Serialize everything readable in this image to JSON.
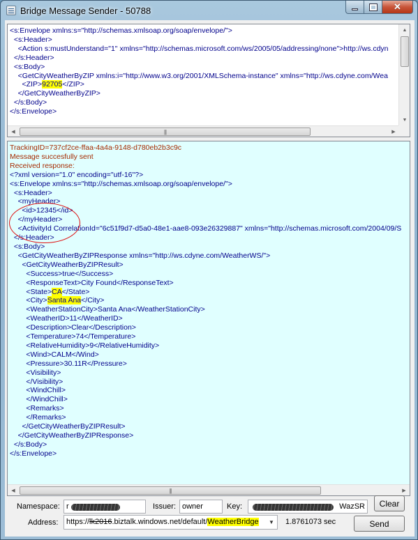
{
  "window": {
    "title": "Bridge Message Sender - 50788",
    "close_color": "#c8553a"
  },
  "request": {
    "lines": [
      {
        "indent": 0,
        "text": "<s:Envelope xmlns:s=\"http://schemas.xmlsoap.org/soap/envelope/\">"
      },
      {
        "indent": 1,
        "text": "<s:Header>"
      },
      {
        "indent": 2,
        "text": "<Action s:mustUnderstand=\"1\" xmlns=\"http://schemas.microsoft.com/ws/2005/05/addressing/none\">http://ws.cdyn"
      },
      {
        "indent": 1,
        "text": "</s:Header>"
      },
      {
        "indent": 1,
        "text": "<s:Body>"
      },
      {
        "indent": 2,
        "text": "<GetCityWeatherByZIP xmlns:i=\"http://www.w3.org/2001/XMLSchema-instance\" xmlns=\"http://ws.cdyne.com/Wea"
      },
      {
        "indent": 3,
        "pre": "<ZIP>",
        "highlight": "92705",
        "post": "</ZIP>"
      },
      {
        "indent": 2,
        "text": "</GetCityWeatherByZIP>"
      },
      {
        "indent": 1,
        "text": "</s:Body>"
      },
      {
        "indent": 0,
        "text": "</s:Envelope>"
      }
    ]
  },
  "response": {
    "status_lines": [
      "TrackingID=737cf2ce-ffaa-4a4a-9148-d780eb2b3c9c",
      "Message succesfully sent",
      "Received response:"
    ],
    "xml_lines": [
      {
        "indent": 0,
        "text": ""
      },
      {
        "indent": 0,
        "text": "<?xml version=\"1.0\" encoding=\"utf-16\"?>"
      },
      {
        "indent": 0,
        "text": "<s:Envelope xmlns:s=\"http://schemas.xmlsoap.org/soap/envelope/\">"
      },
      {
        "indent": 1,
        "text": "<s:Header>"
      },
      {
        "indent": 2,
        "text": "<myHeader>"
      },
      {
        "indent": 3,
        "text": "<id>12345</id>"
      },
      {
        "indent": 2,
        "text": "</myHeader>"
      },
      {
        "indent": 2,
        "text": "<ActivityId CorrelationId=\"6c51f9d7-d5a0-48e1-aae8-093e26329887\" xmlns=\"http://schemas.microsoft.com/2004/09/S"
      },
      {
        "indent": 1,
        "text": "</s:Header>"
      },
      {
        "indent": 1,
        "text": "<s:Body>"
      },
      {
        "indent": 2,
        "text": "<GetCityWeatherByZIPResponse xmlns=\"http://ws.cdyne.com/WeatherWS/\">"
      },
      {
        "indent": 3,
        "text": "<GetCityWeatherByZIPResult>"
      },
      {
        "indent": 4,
        "text": "<Success>true</Success>"
      },
      {
        "indent": 4,
        "text": "<ResponseText>City Found</ResponseText>"
      },
      {
        "indent": 4,
        "pre": "<State>",
        "highlight": "CA",
        "post": "</State>"
      },
      {
        "indent": 4,
        "pre": "<City>",
        "highlight": "Santa Ana",
        "post": "</City>"
      },
      {
        "indent": 4,
        "text": "<WeatherStationCity>Santa Ana</WeatherStationCity>"
      },
      {
        "indent": 4,
        "text": "<WeatherID>11</WeatherID>"
      },
      {
        "indent": 4,
        "text": "<Description>Clear</Description>"
      },
      {
        "indent": 4,
        "text": "<Temperature>74</Temperature>"
      },
      {
        "indent": 4,
        "text": "<RelativeHumidity>9</RelativeHumidity>"
      },
      {
        "indent": 4,
        "text": "<Wind>CALM</Wind>"
      },
      {
        "indent": 4,
        "text": "<Pressure>30.11R</Pressure>"
      },
      {
        "indent": 4,
        "text": "<Visibility>"
      },
      {
        "indent": 4,
        "text": "</Visibility>"
      },
      {
        "indent": 4,
        "text": "<WindChill>"
      },
      {
        "indent": 4,
        "text": "</WindChill>"
      },
      {
        "indent": 4,
        "text": "<Remarks>"
      },
      {
        "indent": 4,
        "text": "</Remarks>"
      },
      {
        "indent": 3,
        "text": "</GetCityWeatherByZIPResult>"
      },
      {
        "indent": 2,
        "text": "</GetCityWeatherByZIPResponse>"
      },
      {
        "indent": 1,
        "text": "</s:Body>"
      },
      {
        "indent": 0,
        "text": "</s:Envelope>"
      }
    ]
  },
  "form": {
    "namespace_label": "Namespace:",
    "namespace_value": "r",
    "issuer_label": "Issuer:",
    "issuer_value": "owner",
    "key_label": "Key:",
    "key_value": "WazSR",
    "clear_label": "Clear",
    "address_label": "Address:",
    "address_prefix": "https://",
    "address_struck": "lk2016",
    "address_middle": ".biztalk.windows.net/default/",
    "address_highlight": "WeatherBridge",
    "elapsed": "1.8761073 sec",
    "send_label": "Send"
  },
  "colors": {
    "response_bg": "#e0ffff",
    "status_text": "#a52a00",
    "highlight": "#ffff00",
    "annotation": "#e01010"
  }
}
